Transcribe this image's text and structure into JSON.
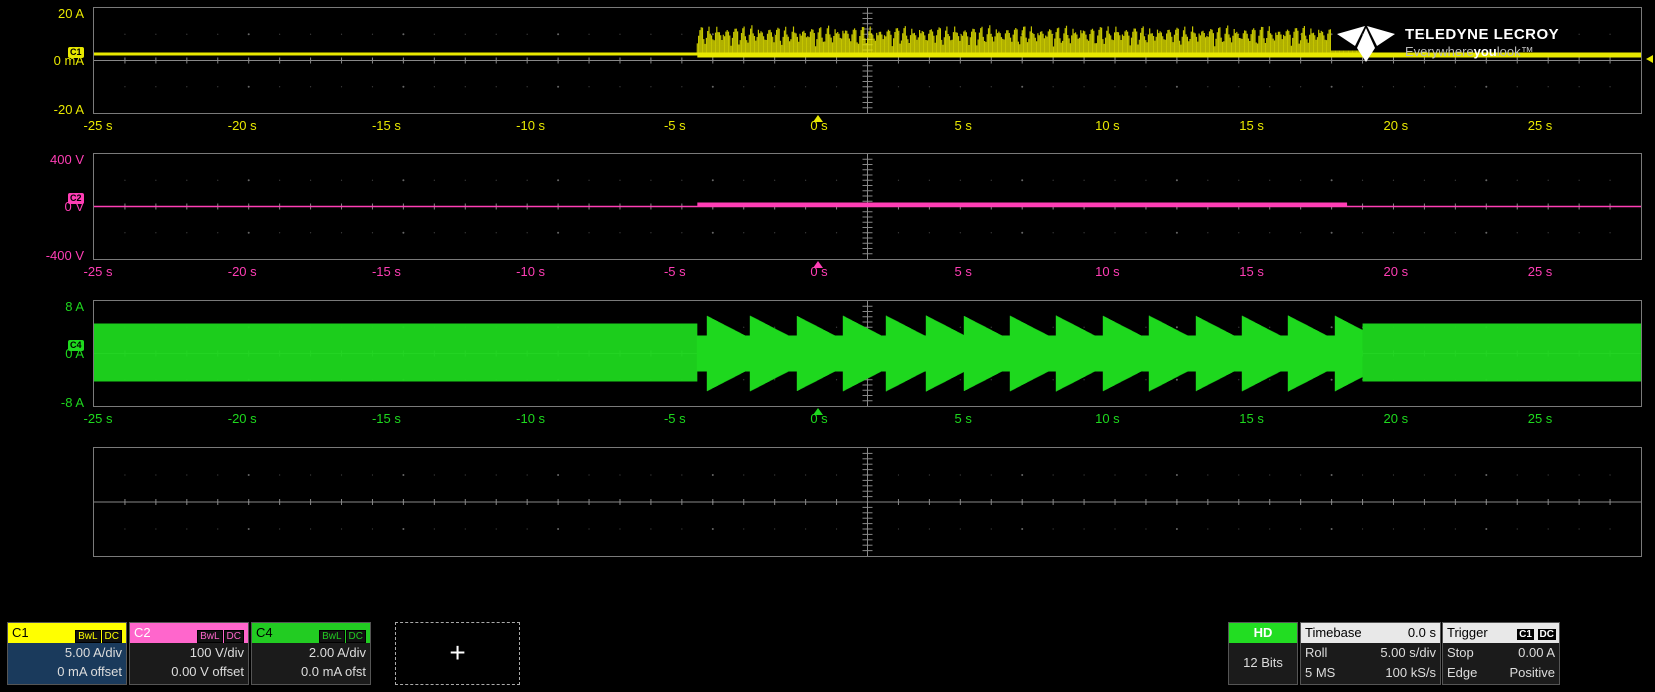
{
  "logo": {
    "brand": "TELEDYNE LECROY",
    "tagline_pre": "Everywhere",
    "tagline_bold": "you",
    "tagline_post": "look™"
  },
  "x_ticks": [
    "-25 s",
    "-20 s",
    "-15 s",
    "-10 s",
    "-5 s",
    "0 s",
    "5 s",
    "10 s",
    "15 s",
    "20 s",
    "25 s"
  ],
  "panels": [
    {
      "name": "C1",
      "color": "#e8e800",
      "tag": "C1",
      "ylabels": [
        "20 A",
        "0 mA",
        "-20 A"
      ]
    },
    {
      "name": "C2",
      "color": "#ff3eb5",
      "tag": "C2",
      "ylabels": [
        "400 V",
        "0 V",
        "-400 V"
      ]
    },
    {
      "name": "C4",
      "color": "#1ed81e",
      "tag": "C4",
      "ylabels": [
        "8 A",
        "0 A",
        "-8 A"
      ]
    }
  ],
  "channels": [
    {
      "label": "C1",
      "color": "#ffff00",
      "tag1": "BwL",
      "tag2": "DC",
      "scale": "5.00 A/div",
      "offset": "0 mA offset"
    },
    {
      "label": "C2",
      "color": "#ff66cc",
      "tag1": "BwL",
      "tag2": "DC",
      "scale": "100 V/div",
      "offset": "0.00 V offset"
    },
    {
      "label": "C4",
      "color": "#22cc22",
      "tag1": "BwL",
      "tag2": "DC",
      "scale": "2.00 A/div",
      "offset": "0.0 mA ofst"
    }
  ],
  "add_channel": "+",
  "hd": {
    "label": "HD",
    "bits": "12 Bits"
  },
  "timebase": {
    "title": "Timebase",
    "delay": "0.0 s",
    "mode": "Roll",
    "per_div": "5.00 s/div",
    "samples": "5 MS",
    "rate": "100 kS/s"
  },
  "trigger": {
    "title": "Trigger",
    "src1": "C1",
    "src2": "DC",
    "state": "Stop",
    "level": "0.00 A",
    "type": "Edge",
    "slope": "Positive"
  }
}
